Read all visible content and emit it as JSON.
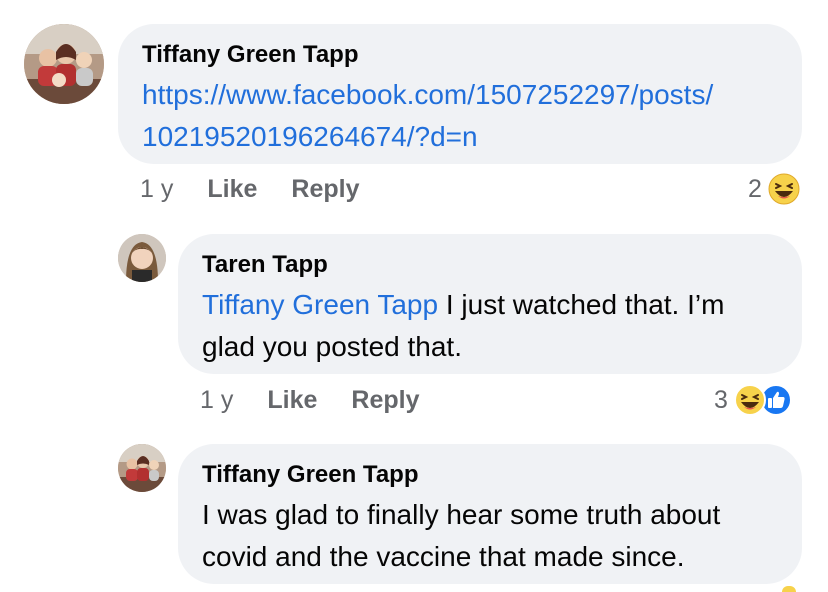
{
  "comments": [
    {
      "author": "Tiffany Green Tapp",
      "body_link": "https://www.facebook.com/1507252297/posts/10219520196264674/?d=n",
      "body_link_line1": "https://www.facebook.com/1507252297/posts/",
      "body_link_line2": "10219520196264674/?d=n",
      "time": "1 y",
      "like_label": "Like",
      "reply_label": "Reply",
      "reaction_count": "2",
      "reactions": [
        "haha-icon"
      ]
    },
    {
      "author": "Taren Tapp",
      "mention": "Tiffany Green Tapp",
      "body_rest_line1": " I just watched that. I’m",
      "body_line2": "glad you posted that.",
      "time": "1 y",
      "like_label": "Like",
      "reply_label": "Reply",
      "reaction_count": "3",
      "reactions": [
        "haha-icon",
        "like-icon"
      ]
    },
    {
      "author": "Tiffany Green Tapp",
      "body_line1": "I was glad to finally hear some truth about",
      "body_line2": "covid and the vaccine that made since."
    }
  ],
  "colors": {
    "bubble": "#f0f2f5",
    "link": "#216fdb",
    "meta": "#65676b",
    "like_blue": "#1877f2",
    "haha_yellow": "#f7d24b"
  }
}
